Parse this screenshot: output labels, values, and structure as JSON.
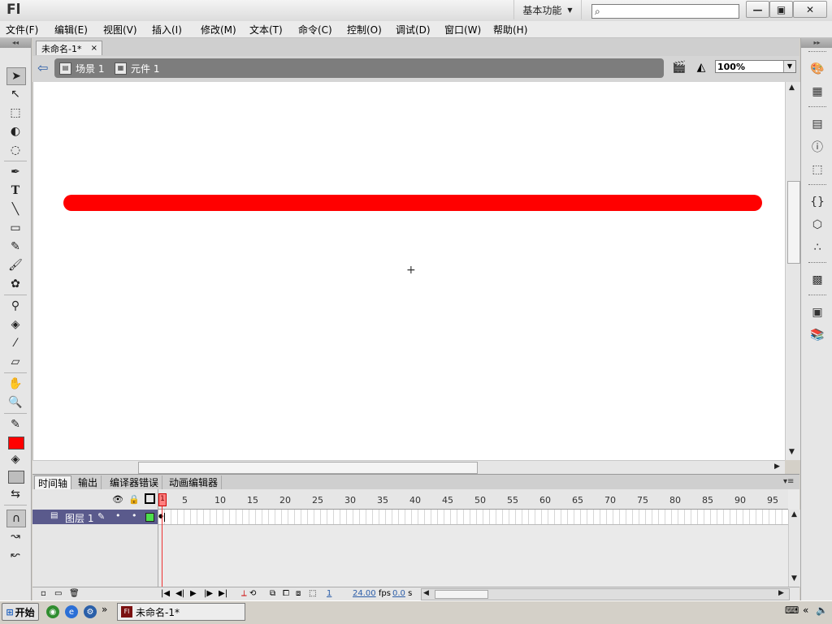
{
  "app": {
    "logo": "Fl",
    "workspace": "基本功能"
  },
  "window_controls": {
    "minimize": "—",
    "maximize": "▣",
    "close": "✕"
  },
  "menu": [
    "文件(F)",
    "编辑(E)",
    "视图(V)",
    "插入(I)",
    "修改(M)",
    "文本(T)",
    "命令(C)",
    "控制(O)",
    "调试(D)",
    "窗口(W)",
    "帮助(H)"
  ],
  "document": {
    "tab_title": "未命名-1*",
    "tab_close": "×"
  },
  "breadcrumb": {
    "scene": "场景 1",
    "symbol": "元件 1"
  },
  "zoom": "100%",
  "stage": {
    "line_color": "#ff0000",
    "background": "#ffffff"
  },
  "timeline": {
    "tabs": [
      "时间轴",
      "输出",
      "编译器错误",
      "动画编辑器"
    ],
    "layer_name": "图层 1",
    "ruler_numbers": [
      "1",
      "5",
      "10",
      "15",
      "20",
      "25",
      "30",
      "35",
      "40",
      "45",
      "50",
      "55",
      "60",
      "65",
      "70",
      "75",
      "80",
      "85",
      "90",
      "95"
    ],
    "current_frame": "1",
    "fps": "24.00",
    "fps_unit": "fps",
    "time": "0.0",
    "time_unit": "s"
  },
  "colors": {
    "stroke": "#ff0000",
    "fill": "#bdbdbd",
    "accent": "#5a5a8c"
  },
  "taskbar": {
    "start": "开始",
    "task_title": "未命名-1*",
    "expand": "»"
  }
}
